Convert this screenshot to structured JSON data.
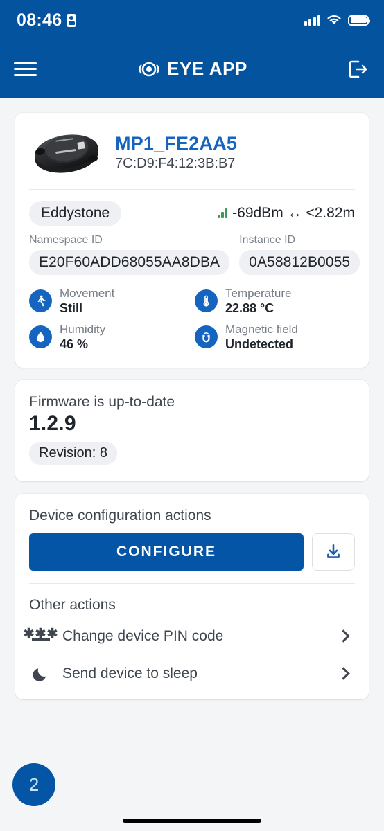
{
  "status_bar": {
    "time": "08:46",
    "badge_icon": "id-badge-icon",
    "cellular_icon": "cellular-signal-icon",
    "wifi_icon": "wifi-icon",
    "battery_icon": "battery-full-icon"
  },
  "app_bar": {
    "menu_icon": "hamburger-menu-icon",
    "logo_icon": "eye-logo-icon",
    "title": "EYE APP",
    "logout_icon": "logout-icon"
  },
  "device": {
    "thumbnail_icon": "beacon-device-photo",
    "name": "MP1_FE2AA5",
    "mac": "7C:D9:F4:12:3B:B7",
    "protocol": "Eddystone",
    "signal_icon": "signal-bars-icon",
    "signal_text": "-69dBm ↔ <2.82m",
    "signal_color": "#3c9a4e",
    "namespace_label": "Namespace ID",
    "namespace_value": "E20F60ADD68055AA8DBA",
    "instance_label": "Instance ID",
    "instance_value": "0A58812B0055",
    "sensors": [
      {
        "icon": "running-person-icon",
        "label": "Movement",
        "value": "Still"
      },
      {
        "icon": "thermometer-icon",
        "label": "Temperature",
        "value": "22.88 °C"
      },
      {
        "icon": "water-drop-icon",
        "label": "Humidity",
        "value": "46 %"
      },
      {
        "icon": "magnet-icon",
        "label": "Magnetic field",
        "value": "Undetected"
      }
    ]
  },
  "firmware": {
    "status": "Firmware is up-to-date",
    "version": "1.2.9",
    "revision": "Revision: 8"
  },
  "actions": {
    "config_title": "Device configuration actions",
    "configure_label": "CONFIGURE",
    "download_icon": "download-icon",
    "other_title": "Other actions",
    "items": [
      {
        "icon": "pin-code-icon",
        "label": "Change device PIN code",
        "chevron": "chevron-right-icon"
      },
      {
        "icon": "moon-icon",
        "label": "Send device to sleep",
        "chevron": "chevron-right-icon"
      }
    ]
  },
  "fab": {
    "count": "2"
  },
  "theme": {
    "primary_blue": "#04539f",
    "button_blue": "#0455a6",
    "link_blue": "#1565c0",
    "page_bg": "#f4f5f7"
  }
}
